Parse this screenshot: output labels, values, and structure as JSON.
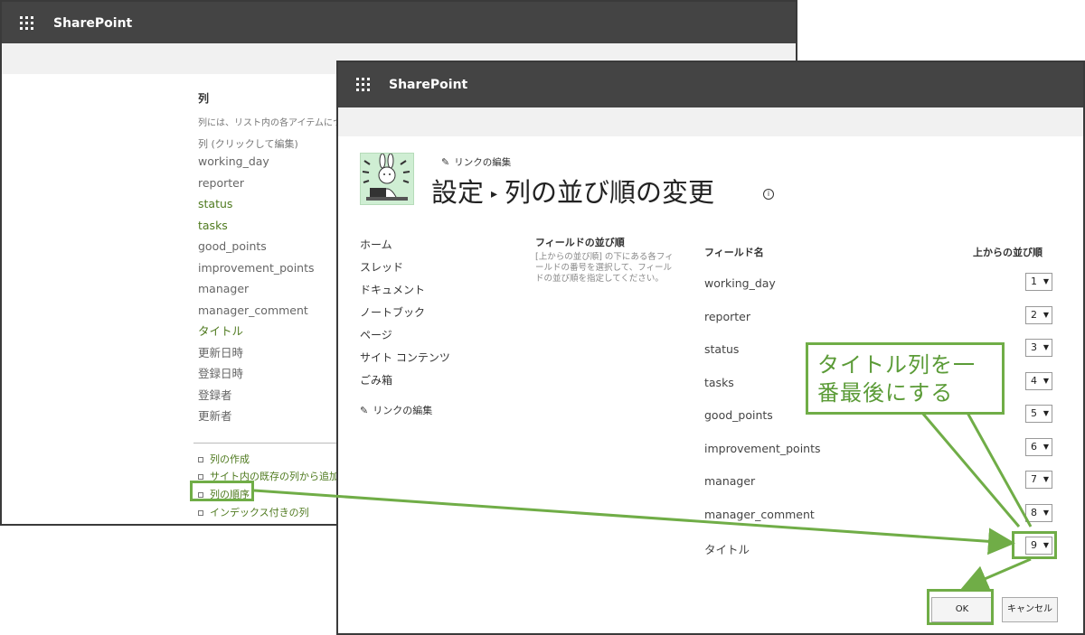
{
  "back_window": {
    "app_title": "SharePoint",
    "columns_heading": "列",
    "columns_desc": "列には、リスト内の各アイテムについて",
    "columns_click": "列 (クリックして編集)",
    "columns": [
      {
        "label": "working_day",
        "green": false
      },
      {
        "label": "reporter",
        "green": false
      },
      {
        "label": "status",
        "green": true
      },
      {
        "label": "tasks",
        "green": true
      },
      {
        "label": "good_points",
        "green": false
      },
      {
        "label": "improvement_points",
        "green": false
      },
      {
        "label": "manager",
        "green": false
      },
      {
        "label": "manager_comment",
        "green": false
      },
      {
        "label": "タイトル",
        "green": true
      },
      {
        "label": "更新日時",
        "green": false
      },
      {
        "label": "登録日時",
        "green": false
      },
      {
        "label": "登録者",
        "green": false
      },
      {
        "label": "更新者",
        "green": false
      }
    ],
    "links": [
      "列の作成",
      "サイト内の既存の列から追加",
      "列の順序",
      "インデックス付きの列"
    ]
  },
  "front_window": {
    "app_title": "SharePoint",
    "edit_links_label": "リンクの編集",
    "breadcrumb_root": "設定",
    "breadcrumb_page": "列の並び順の変更",
    "nav": [
      "ホーム",
      "スレッド",
      "ドキュメント",
      "ノートブック",
      "ページ",
      "サイト コンテンツ",
      "ごみ箱"
    ],
    "nav_edit": "リンクの編集",
    "section_title": "フィールドの並び順",
    "section_desc": "[上からの並び順] の下にある各フィールドの番号を選択して、フィールドの並び順を指定してください。",
    "header_field": "フィールド名",
    "header_order": "上からの並び順",
    "fields": [
      {
        "name": "working_day",
        "order": "1"
      },
      {
        "name": "reporter",
        "order": "2"
      },
      {
        "name": "status",
        "order": "3"
      },
      {
        "name": "tasks",
        "order": "4"
      },
      {
        "name": "good_points",
        "order": "5"
      },
      {
        "name": "improvement_points",
        "order": "6"
      },
      {
        "name": "manager",
        "order": "7"
      },
      {
        "name": "manager_comment",
        "order": "8"
      },
      {
        "name": "タイトル",
        "order": "9"
      }
    ],
    "ok_label": "OK",
    "cancel_label": "キャンセル"
  },
  "annotation": {
    "line1": "タイトル列を一",
    "line2": "番最後にする",
    "color": "#70ad47"
  }
}
